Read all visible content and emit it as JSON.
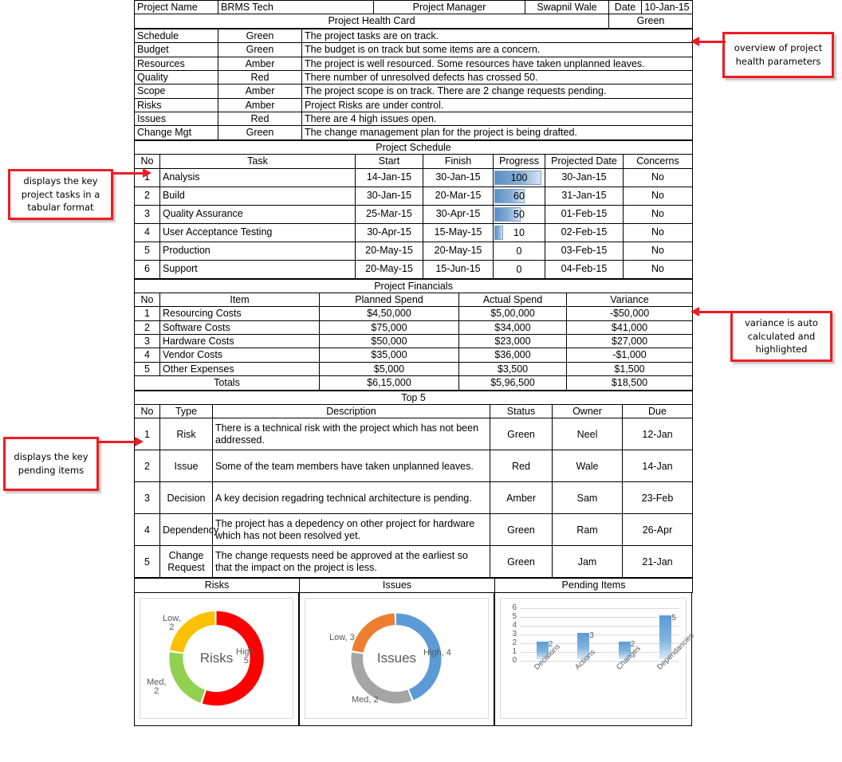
{
  "header": {
    "project_name_label": "Project Name",
    "project_name_value": "BRMS Tech",
    "project_manager_label": "Project Manager",
    "project_manager_value": "Swapnil Wale",
    "date_label": "Date",
    "date_value": "10-Jan-15"
  },
  "health_card": {
    "title": "Project Health Card",
    "overall_status": "Green",
    "rows": [
      {
        "name": "Schedule",
        "status": "Green",
        "desc": "The project tasks are on track."
      },
      {
        "name": "Budget",
        "status": "Green",
        "desc": "The budget is on track but some items are a concern."
      },
      {
        "name": "Resources",
        "status": "Amber",
        "desc": "The project is well resourced. Some resources have taken unplanned leaves."
      },
      {
        "name": "Quality",
        "status": "Red",
        "desc": "There number of unresolved defects has crossed 50."
      },
      {
        "name": "Scope",
        "status": "Amber",
        "desc": "The project scope is on track. There are 2 change requests pending."
      },
      {
        "name": "Risks",
        "status": "Amber",
        "desc": "Project Risks are under control."
      },
      {
        "name": "Issues",
        "status": "Red",
        "desc": "There are 4 high issues open."
      },
      {
        "name": "Change Mgt",
        "status": "Green",
        "desc": "The change management plan for the project is being drafted."
      }
    ]
  },
  "schedule": {
    "title": "Project Schedule",
    "columns": [
      "No",
      "Task",
      "Start",
      "Finish",
      "Progress",
      "Projected Date",
      "Concerns"
    ],
    "rows": [
      {
        "no": "1",
        "task": "Analysis",
        "start": "14-Jan-15",
        "finish": "30-Jan-15",
        "progress": "100",
        "projected": "30-Jan-15",
        "concerns": "No"
      },
      {
        "no": "2",
        "task": "Build",
        "start": "30-Jan-15",
        "finish": "20-Mar-15",
        "progress": "60",
        "projected": "31-Jan-15",
        "concerns": "No"
      },
      {
        "no": "3",
        "task": "Quality Assurance",
        "start": "25-Mar-15",
        "finish": "30-Apr-15",
        "progress": "50",
        "projected": "01-Feb-15",
        "concerns": "No"
      },
      {
        "no": "4",
        "task": "User Acceptance Testing",
        "start": "30-Apr-15",
        "finish": "15-May-15",
        "progress": "10",
        "projected": "02-Feb-15",
        "concerns": "No"
      },
      {
        "no": "5",
        "task": "Production",
        "start": "20-May-15",
        "finish": "20-May-15",
        "progress": "0",
        "projected": "03-Feb-15",
        "concerns": "No"
      },
      {
        "no": "6",
        "task": "Support",
        "start": "20-May-15",
        "finish": "15-Jun-15",
        "progress": "0",
        "projected": "04-Feb-15",
        "concerns": "No"
      }
    ]
  },
  "financials": {
    "title": "Project Financials",
    "columns": [
      "No",
      "Item",
      "Planned Spend",
      "Actual Spend",
      "Variance"
    ],
    "rows": [
      {
        "no": "1",
        "item": "Resourcing Costs",
        "planned": "$4,50,000",
        "actual": "$5,00,000",
        "variance": "-$50,000",
        "variance_state": "negative"
      },
      {
        "no": "2",
        "item": "Software Costs",
        "planned": "$75,000",
        "actual": "$34,000",
        "variance": "$41,000",
        "variance_state": "positive"
      },
      {
        "no": "3",
        "item": "Hardware Costs",
        "planned": "$50,000",
        "actual": "$23,000",
        "variance": "$27,000",
        "variance_state": "positive"
      },
      {
        "no": "4",
        "item": "Vendor Costs",
        "planned": "$35,000",
        "actual": "$36,000",
        "variance": "-$1,000",
        "variance_state": "negative"
      },
      {
        "no": "5",
        "item": "Other Expenses",
        "planned": "$5,000",
        "actual": "$3,500",
        "variance": "$1,500",
        "variance_state": "positive"
      }
    ],
    "totals": {
      "label": "Totals",
      "planned": "$6,15,000",
      "actual": "$5,96,500",
      "variance": "$18,500"
    }
  },
  "top5": {
    "title": "Top 5",
    "columns": [
      "No",
      "Type",
      "Description",
      "Status",
      "Owner",
      "Due"
    ],
    "rows": [
      {
        "no": "1",
        "type": "Risk",
        "desc": "There is a technical risk with the project which has not been addressed.",
        "status": "Green",
        "owner": "Neel",
        "due": "12-Jan"
      },
      {
        "no": "2",
        "type": "Issue",
        "desc": "Some of the team members have taken unplanned leaves.",
        "status": "Red",
        "owner": "Wale",
        "due": "14-Jan"
      },
      {
        "no": "3",
        "type": "Decision",
        "desc": "A key decision regadring technical architecture is pending.",
        "status": "Amber",
        "owner": "Sam",
        "due": "23-Feb"
      },
      {
        "no": "4",
        "type": "Dependency",
        "desc": "The project has a depedency on other project for hardware which has not been resolved yet.",
        "status": "Green",
        "owner": "Ram",
        "due": "26-Apr"
      },
      {
        "no": "5",
        "type": "Change Request",
        "desc": "The change requests need be approved at the earliest so that the impact on the project is less.",
        "status": "Green",
        "owner": "Jam",
        "due": "21-Jan"
      }
    ]
  },
  "panels": {
    "risks_title": "Risks",
    "issues_title": "Issues",
    "pending_title": "Pending Items"
  },
  "callouts": [
    {
      "text": "overview of project health parameters"
    },
    {
      "text": "displays the key project tasks in a tabular format"
    },
    {
      "text": "variance is auto calculated and highlighted"
    },
    {
      "text": "displays the key pending items"
    }
  ],
  "chart_data": [
    {
      "type": "pie",
      "title": "Risks",
      "center_label": "Risks",
      "categories": [
        "High",
        "Low",
        "Med"
      ],
      "values": [
        5,
        2,
        2
      ],
      "labels": [
        "High, 5",
        "Low, 2",
        "Med, 2"
      ],
      "colors": [
        "#ff0000",
        "#92d050",
        "#ffc000"
      ],
      "legend": "none",
      "donut": true
    },
    {
      "type": "pie",
      "title": "Issues",
      "center_label": "Issues",
      "categories": [
        "High",
        "Low",
        "Med"
      ],
      "values": [
        4,
        3,
        2
      ],
      "labels": [
        "High, 4",
        "Low, 3",
        "Med, 2"
      ],
      "colors": [
        "#5b9bd5",
        "#a5a5a5",
        "#ed7d31"
      ],
      "legend": "none",
      "donut": true
    },
    {
      "type": "bar",
      "title": "Pending Items",
      "categories": [
        "Decisions",
        "Actions",
        "Changes",
        "Dependancies"
      ],
      "values": [
        2,
        3,
        2,
        5
      ],
      "ylim": [
        0,
        6
      ],
      "yticks": [
        "0",
        "1",
        "2",
        "3",
        "4",
        "5",
        "6"
      ],
      "xlabel": "",
      "ylabel": "",
      "grid": true,
      "legend": "none",
      "color": "#5b9bd5"
    }
  ]
}
